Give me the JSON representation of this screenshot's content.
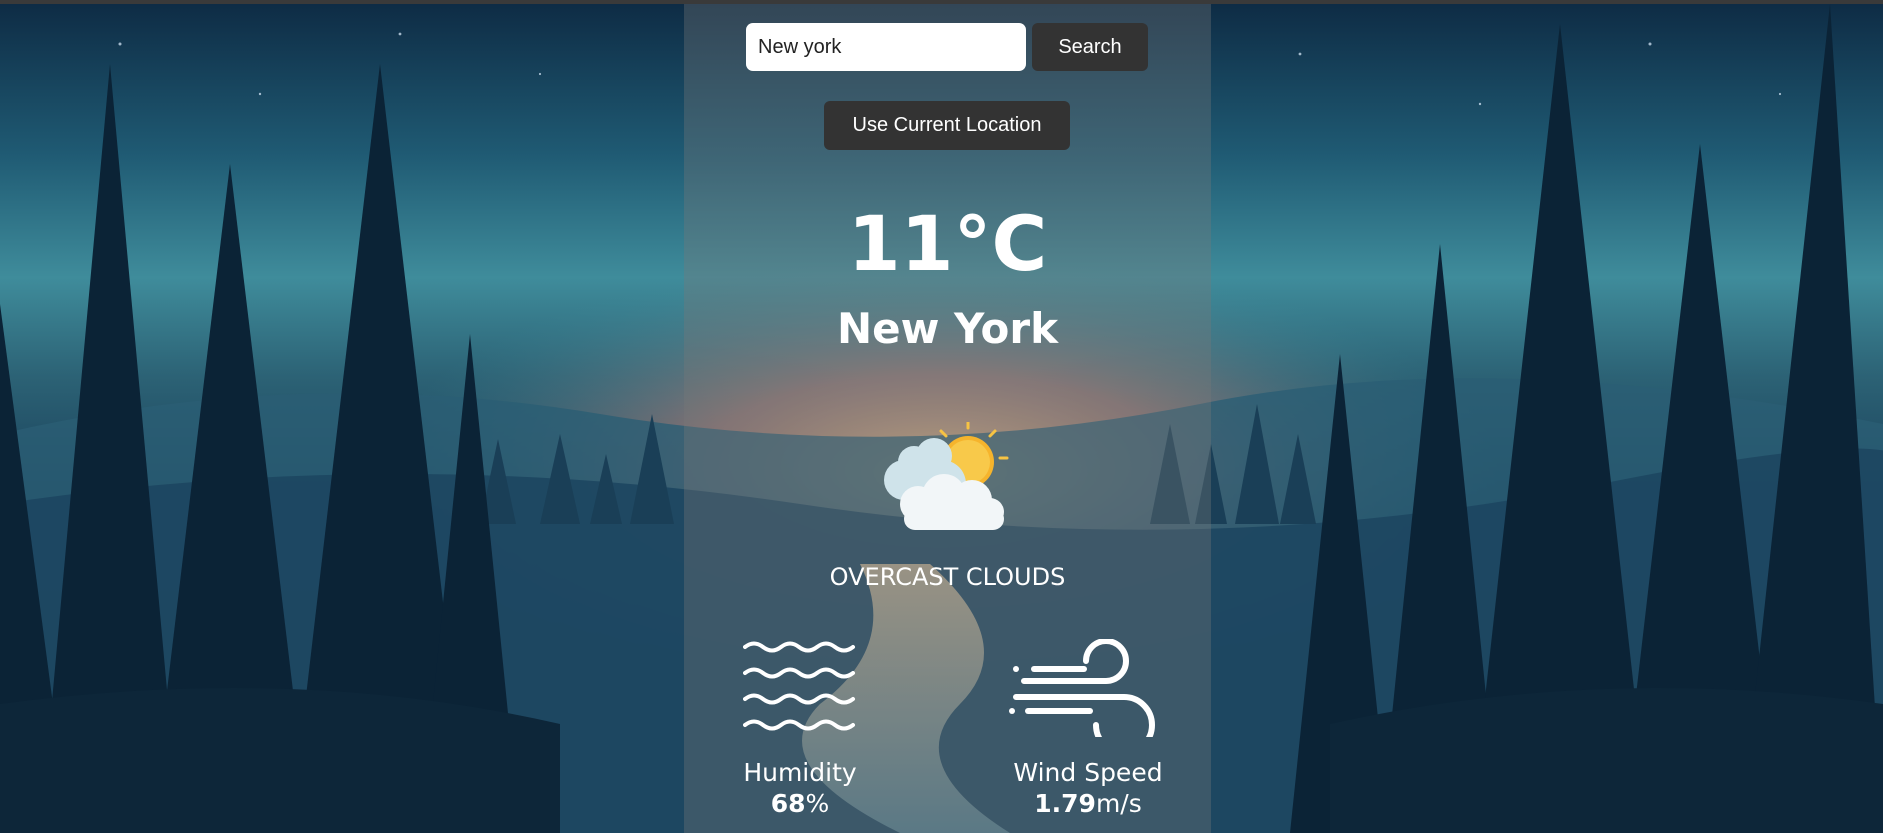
{
  "search": {
    "input_value": "New york",
    "button_label": "Search"
  },
  "location_button_label": "Use Current Location",
  "weather": {
    "temperature": "11°C",
    "city": "New York",
    "description": "OVERCAST CLOUDS",
    "icon": "sun-behind-clouds-icon"
  },
  "stats": {
    "humidity": {
      "label": "Humidity",
      "value": "68",
      "unit": "%",
      "icon": "humidity-waves-icon"
    },
    "wind": {
      "label": "Wind Speed",
      "value": "1.79",
      "unit": "m/s",
      "icon": "wind-icon"
    }
  },
  "colors": {
    "card_overlay": "rgba(120,120,120,0.35)",
    "button_bg": "#333333",
    "text": "#ffffff"
  }
}
